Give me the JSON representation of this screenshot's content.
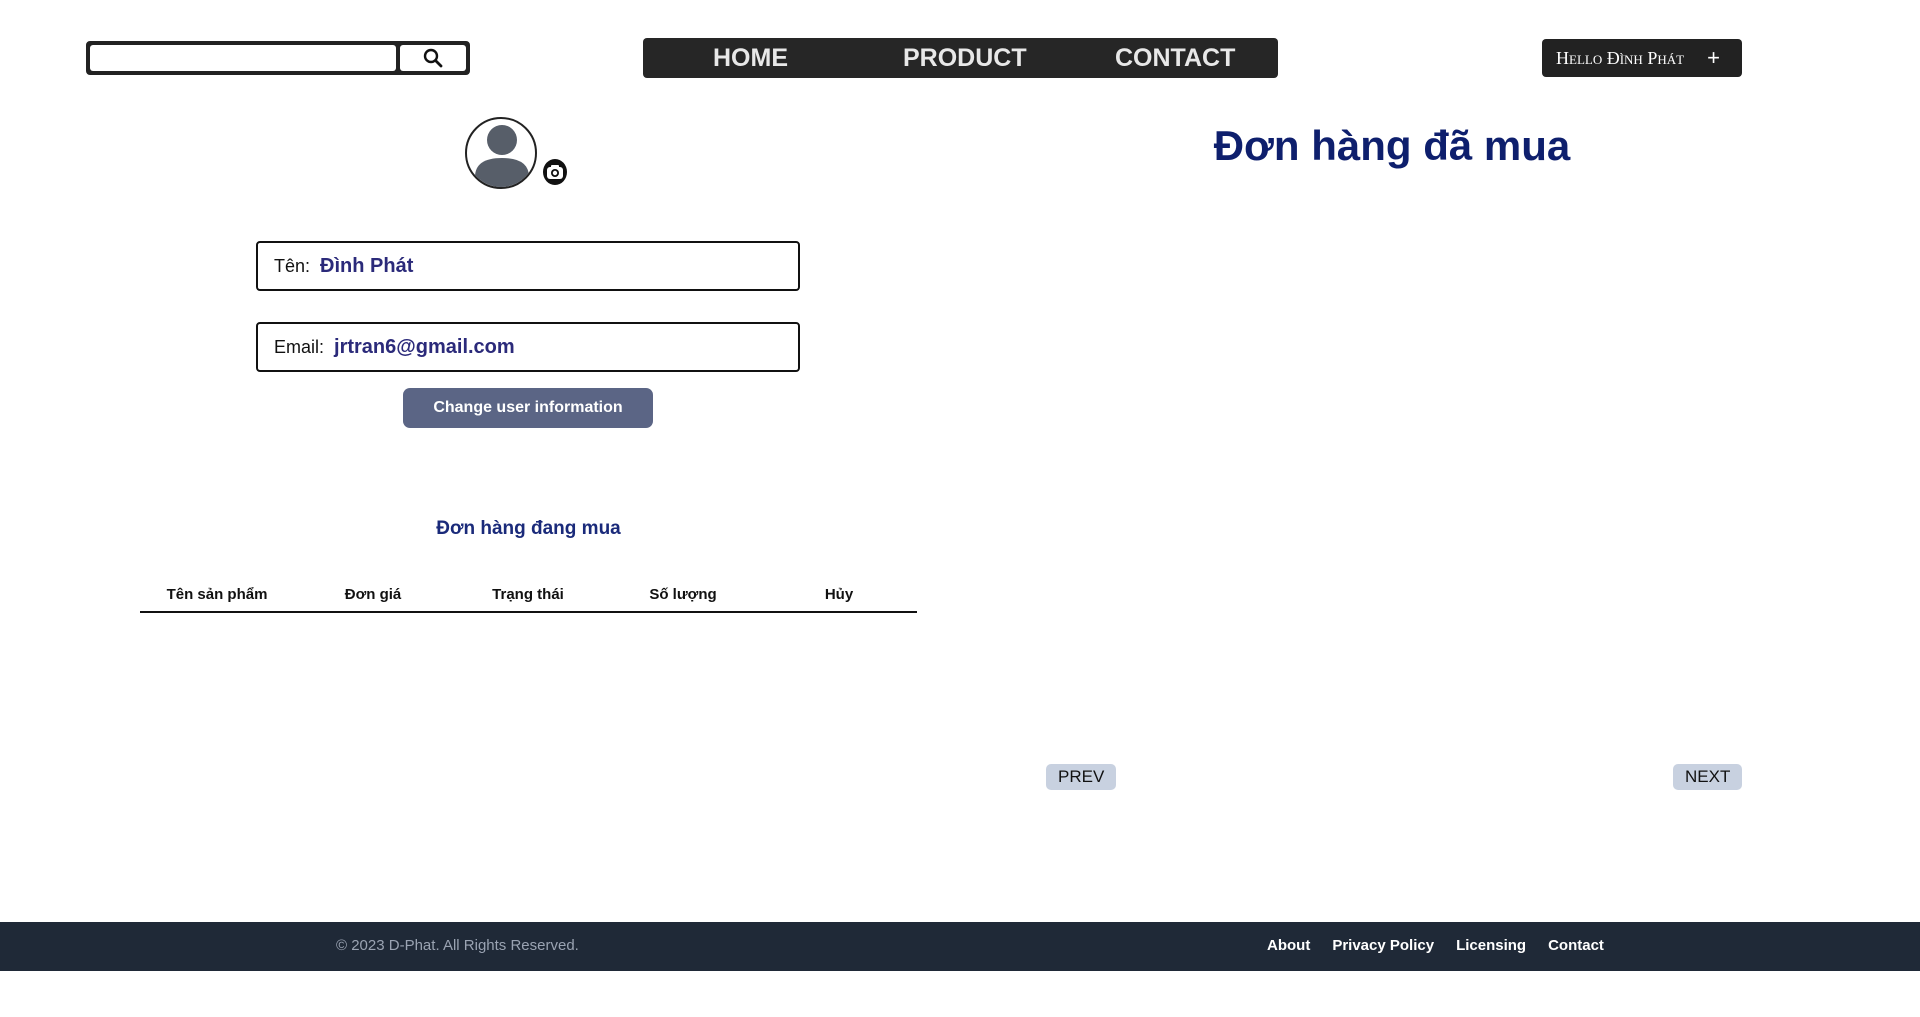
{
  "header": {
    "search": {
      "value": "",
      "placeholder": ""
    },
    "nav": {
      "home": "HOME",
      "product": "PRODUCT",
      "contact": "CONTACT"
    },
    "user_menu": {
      "greeting": "Hello Đình Phát",
      "plus": "+"
    }
  },
  "profile": {
    "name_label": "Tên:",
    "name_value": "Đình Phát",
    "email_label": "Email:",
    "email_value": "jrtran6@gmail.com",
    "change_button": "Change user information"
  },
  "current_orders": {
    "title": "Đơn hàng đang mua",
    "columns": [
      "Tên sản phẩm",
      "Đơn giá",
      "Trạng thái",
      "Số lượng",
      "Hủy"
    ],
    "rows": []
  },
  "order_history": {
    "title": "Đơn hàng đã mua",
    "prev": "PREV",
    "next": "NEXT"
  },
  "footer": {
    "copyright": "© 2023 D-Phat. All Rights Reserved.",
    "links": [
      "About",
      "Privacy Policy",
      "Licensing",
      "Contact"
    ]
  },
  "colors": {
    "accent_title": "#0e1f6d",
    "button": "#5b6585",
    "footer_bg": "#1f2937"
  }
}
